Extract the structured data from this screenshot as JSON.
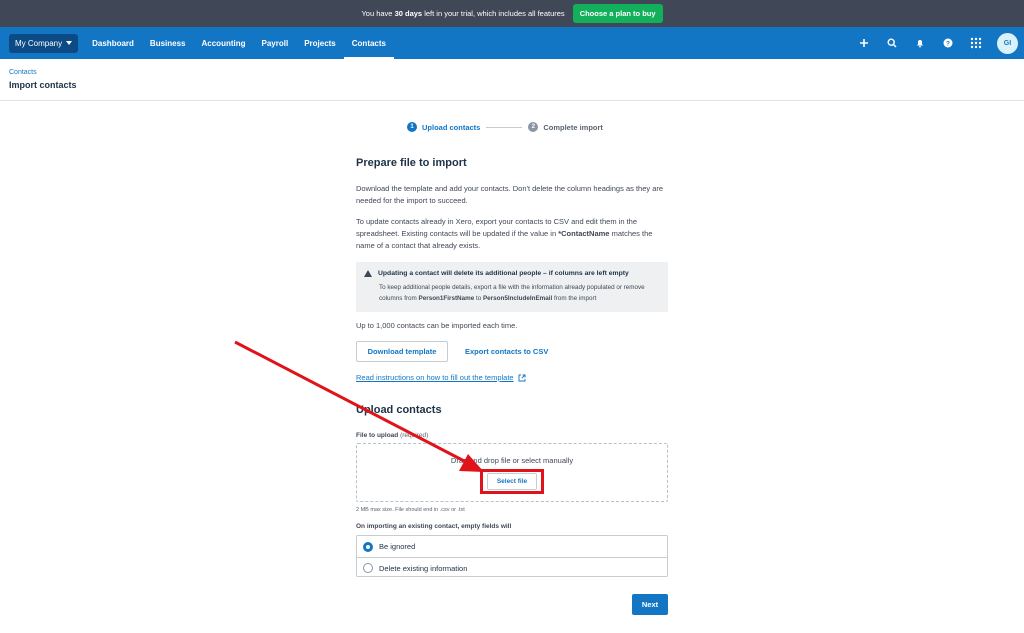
{
  "trial": {
    "prefix": "You have",
    "days": "30 days",
    "suffix": "left in your trial, which includes all features",
    "cta": "Choose a plan to buy"
  },
  "nav": {
    "org": "My Company",
    "items": [
      "Dashboard",
      "Business",
      "Accounting",
      "Payroll",
      "Projects",
      "Contacts"
    ],
    "active": "Contacts",
    "icons": [
      "plus-icon",
      "search-icon",
      "bell-icon",
      "help-icon",
      "apps-grid-icon"
    ],
    "avatar": "GI"
  },
  "page": {
    "breadcrumb": "Contacts",
    "title": "Import contacts"
  },
  "stepper": {
    "step1_num": "1",
    "step1_label": "Upload contacts",
    "step2_num": "2",
    "step2_label": "Complete import"
  },
  "prepare": {
    "heading": "Prepare file to import",
    "para1": "Download the template and add your contacts. Don't delete the column headings as they are needed for the import to succeed.",
    "para2_a": "To update contacts already in Xero, export your contacts to CSV and edit them in the spreadsheet. Existing contacts will be updated if the value in ",
    "para2_b": "*ContactName",
    "para2_c": " matches the name of a contact that already exists.",
    "warn_title": "Updating a contact will delete its additional people – if columns are left empty",
    "warn_a": "To keep additional people details, export a file with the information already populated or remove columns from ",
    "warn_b": "Person1FirstName",
    "warn_c": " to ",
    "warn_d": "Person5IncludeInEmail",
    "warn_e": " from the import",
    "limit": "Up to 1,000 contacts can be imported each time.",
    "download_btn": "Download template",
    "export_btn": "Export contacts to CSV",
    "instructions_link": "Read instructions on how to fill out the template"
  },
  "upload": {
    "heading": "Upload contacts",
    "field_label": "File to upload",
    "required": "(required)",
    "drop_text": "Drag and drop file or select manually",
    "select_btn": "Select file",
    "hint": "2 MB max size. File should end in .csv or .txt"
  },
  "options": {
    "label": "On importing an existing contact, empty fields will",
    "choices": [
      "Be ignored",
      "Delete existing information"
    ],
    "selected": "Be ignored"
  },
  "next_btn": "Next",
  "colors": {
    "brand": "#1376c5",
    "banner": "#404756",
    "cta": "#13b05b",
    "annotation": "#e0121a"
  }
}
